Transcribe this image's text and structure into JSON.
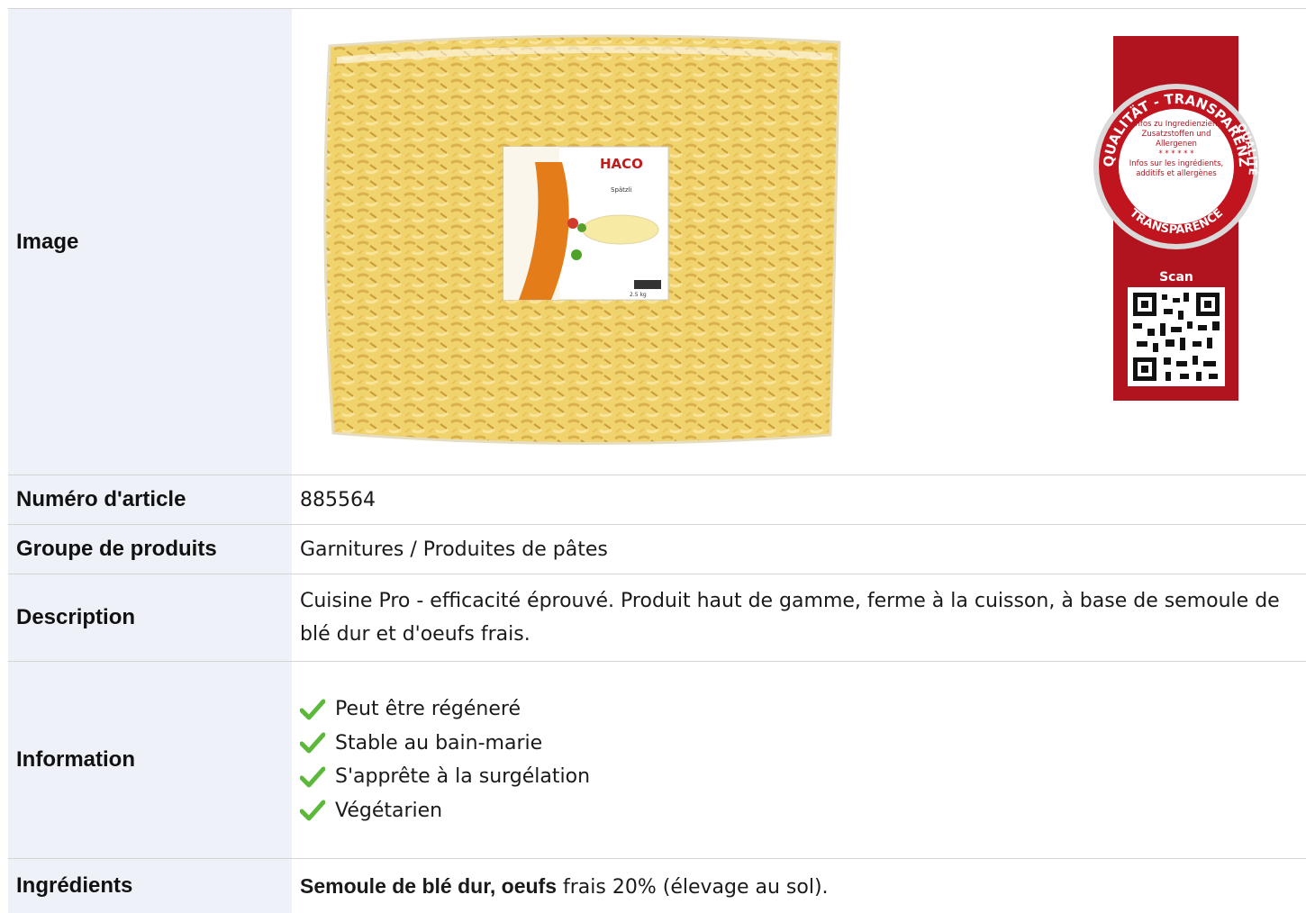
{
  "rows": {
    "image": {
      "label": "Image"
    },
    "article": {
      "label": "Numéro d'article",
      "value": "885564"
    },
    "group": {
      "label": "Groupe de produits",
      "value": "Garnitures / Produites de pâtes"
    },
    "description": {
      "label": "Description",
      "value": "Cuisine Pro - efficacité éprouvé. Produit haut de gamme, ferme à la cuisson, à base de semoule de blé dur et d'oeufs frais."
    },
    "information": {
      "label": "Information",
      "items": [
        "Peut être régéneré",
        "Stable au bain-marie",
        "S'apprête à la surgélation",
        "Végétarien"
      ]
    },
    "ingredients": {
      "label": "Ingrédients",
      "bold": "Semoule de blé dur, oeufs",
      "rest": " frais 20% (élevage au sol)."
    }
  },
  "product_label": {
    "brand": "HACO",
    "product": "Spätzli",
    "weight": "2.5 kg"
  },
  "badge": {
    "ring_top": "QUALITÄT - TRANSPARENZ",
    "ring_right": "QUALITÉ",
    "ring_bottom": "TRANSPARENCE",
    "text_de": "Infos zu Ingredienzien, Zusatzstoffen und Allergenen",
    "stars": "* * * * * *",
    "text_fr": "Infos sur les ingrédients, additifs et allergènes",
    "scan": "Scan"
  },
  "colors": {
    "label_bg": "#eef2f8",
    "border": "#d4d4d4",
    "check": "#5bb83a",
    "badge_red": "#b2141f"
  }
}
